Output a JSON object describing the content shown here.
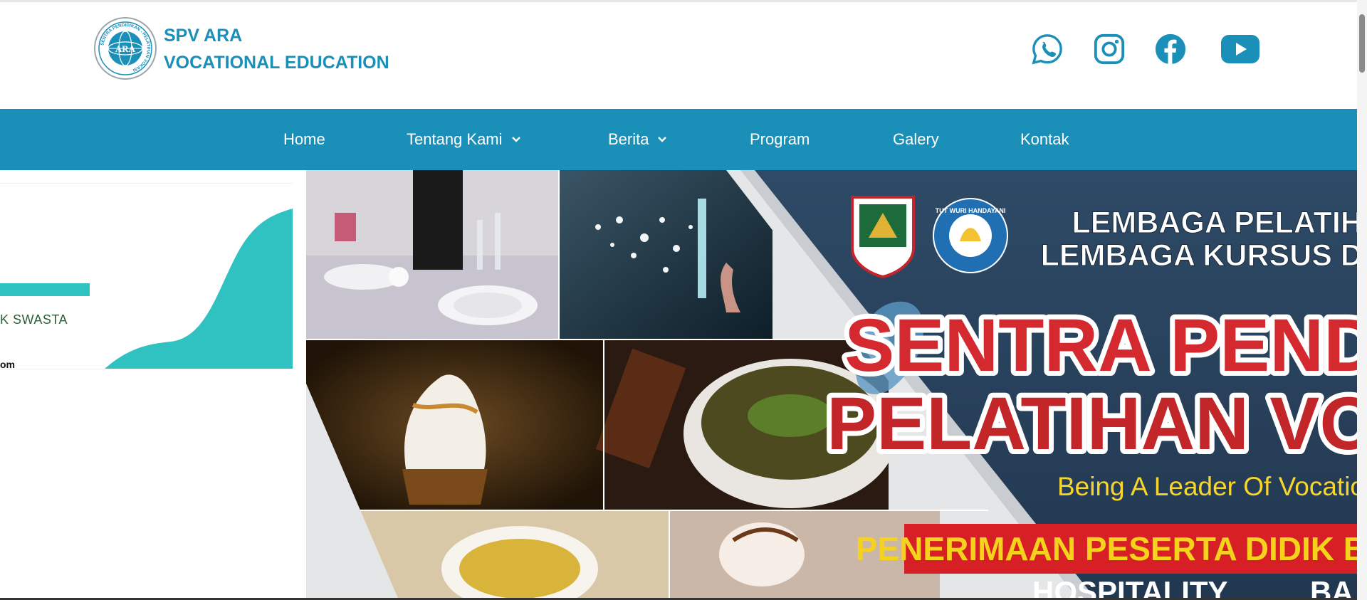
{
  "brand": {
    "name_line1": "SPV ARA",
    "name_line2": "VOCATIONAL EDUCATION",
    "logo_ring_text": "SENTRA PENDIDIKAN - PELATIHAN VOKASI",
    "logo_center": "ARA",
    "color": "#1a8fb8"
  },
  "social": [
    "whatsapp-icon",
    "instagram-icon",
    "facebook-icon",
    "youtube-icon"
  ],
  "nav": {
    "items": [
      {
        "label": "Home"
      },
      {
        "label": "Tentang Kami"
      },
      {
        "label": "Berita"
      },
      {
        "label": "Program"
      },
      {
        "label": "Galery"
      },
      {
        "label": "Kontak"
      }
    ],
    "background": "#1a8fb8"
  },
  "slide_left": {
    "text1": "K SWASTA",
    "text2": "om",
    "accent": "#2fc2c0"
  },
  "banner": {
    "line1": "LEMBAGA PELATIHA",
    "line2": "LEMBAGA KURSUS DA",
    "title1": "SENTRA PEND",
    "title2": "PELATIHAN VO",
    "tagline": "Being A Leader Of Vocatio",
    "strip": "PENERIMAAN PESERTA DIDIK B",
    "bottom_left": "HOSPITALITY",
    "bottom_right": "BA",
    "seal_text": "TUT WURI HANDAYANI"
  }
}
